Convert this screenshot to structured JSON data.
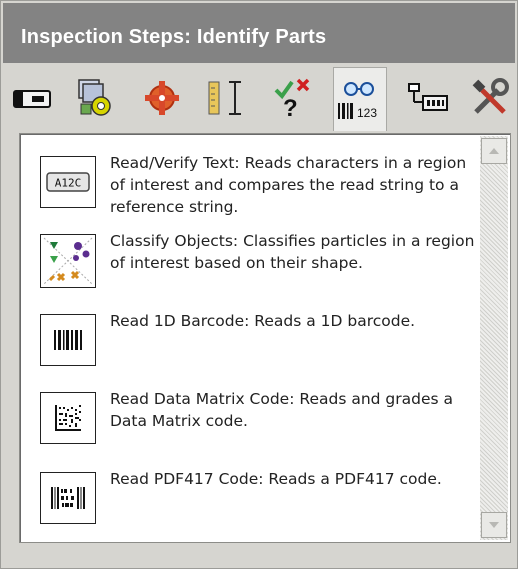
{
  "title": "Inspection Steps: Identify Parts",
  "toolbar": {
    "tools": [
      {
        "icon": "camera-icon"
      },
      {
        "icon": "image-processing-icon"
      },
      {
        "icon": "locate-target-icon"
      },
      {
        "icon": "measure-icon"
      },
      {
        "icon": "check-pass-fail-icon"
      },
      {
        "icon": "identify-parts-icon",
        "label": "123"
      },
      {
        "icon": "communication-icon"
      },
      {
        "icon": "tools-icon"
      }
    ]
  },
  "steps": [
    {
      "icon": "read-verify-text-icon",
      "icon_label": "A12C",
      "text": "Read/Verify Text:  Reads characters in a region of interest and compares the read string to a reference string."
    },
    {
      "icon": "classify-objects-icon",
      "text": "Classify Objects:  Classifies particles in a region of interest based on their shape."
    },
    {
      "icon": "barcode-1d-icon",
      "text": "Read 1D Barcode:  Reads a 1D barcode."
    },
    {
      "icon": "data-matrix-icon",
      "text": "Read Data Matrix Code:  Reads and grades a Data Matrix code."
    },
    {
      "icon": "pdf417-icon",
      "text": "Read PDF417 Code:  Reads a PDF417 code."
    }
  ],
  "colors": {
    "titlebar": "#838383",
    "panel": "#d6d5d0",
    "list": "#ffffff"
  }
}
